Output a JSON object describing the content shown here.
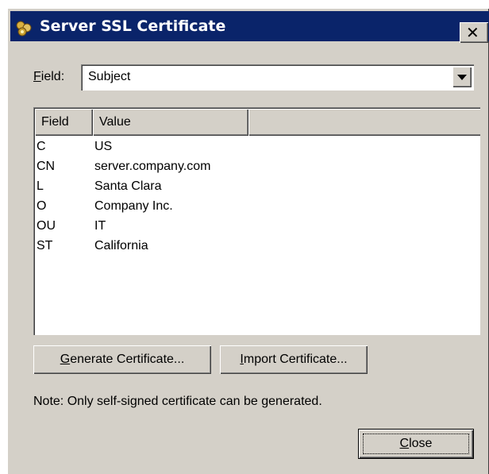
{
  "window": {
    "title": "Server SSL Certificate",
    "close_glyph": "✕"
  },
  "field_select": {
    "label_prefix": "F",
    "label_rest": "ield:",
    "value": "Subject"
  },
  "listview": {
    "columns": [
      "Field",
      "Value",
      ""
    ],
    "rows": [
      {
        "field": "C",
        "value": "US"
      },
      {
        "field": "CN",
        "value": "server.company.com"
      },
      {
        "field": "L",
        "value": "Santa Clara"
      },
      {
        "field": "O",
        "value": "Company Inc."
      },
      {
        "field": "OU",
        "value": "IT"
      },
      {
        "field": "ST",
        "value": "California"
      }
    ]
  },
  "buttons": {
    "generate": {
      "ul": "G",
      "rest": "enerate Certificate..."
    },
    "import": {
      "ul": "I",
      "rest": "mport Certificate..."
    },
    "close": {
      "ul": "C",
      "rest": "lose"
    }
  },
  "note": "Note: Only self-signed certificate can be generated.",
  "icons": {
    "title_icon": "certificate-icon",
    "dropdown_arrow": "chevron-down-icon"
  },
  "colors": {
    "titlebar": "#0a246a",
    "dialog_face": "#d4d0c8"
  }
}
